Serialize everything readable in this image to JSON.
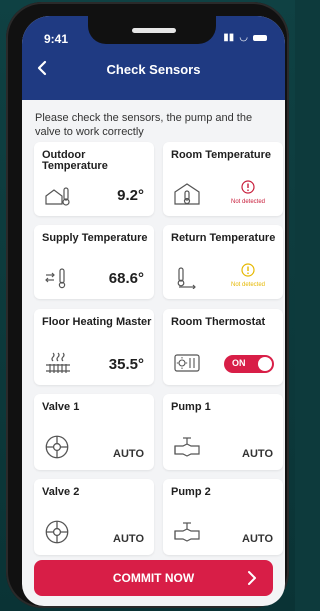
{
  "status_bar": {
    "time": "9:41"
  },
  "header": {
    "title": "Check Sensors"
  },
  "intro_text": "Please check the sensors, the pump and the valve to work correctly",
  "sensors": [
    {
      "title": "Outdoor Temperature",
      "value": "9.2°",
      "icon": "outdoor-thermometer-icon"
    },
    {
      "title": "Room Temperature",
      "status": "Not detected",
      "status_color": "#c81e3b",
      "icon": "room-thermometer-icon"
    },
    {
      "title": "Supply Temperature",
      "value": "68.6°",
      "icon": "supply-thermometer-icon"
    },
    {
      "title": "Return Temperature",
      "status": "Not detected",
      "status_color": "#e6b800",
      "icon": "return-thermometer-icon"
    },
    {
      "title": "Floor Heating Master",
      "value": "35.5°",
      "icon": "floor-heating-icon"
    },
    {
      "title": "Room Thermostat",
      "toggle": "ON",
      "icon": "thermostat-icon"
    },
    {
      "title": "Valve 1",
      "mode": "AUTO",
      "icon": "valve-icon"
    },
    {
      "title": "Pump 1",
      "mode": "AUTO",
      "icon": "pump-icon"
    },
    {
      "title": "Valve 2",
      "mode": "AUTO",
      "icon": "valve-icon"
    },
    {
      "title": "Pump 2",
      "mode": "AUTO",
      "icon": "pump-icon"
    }
  ],
  "commit_button": {
    "label": "COMMIT NOW"
  },
  "colors": {
    "header": "#1f3a82",
    "accent": "#d81e47",
    "warning": "#e6b800"
  }
}
